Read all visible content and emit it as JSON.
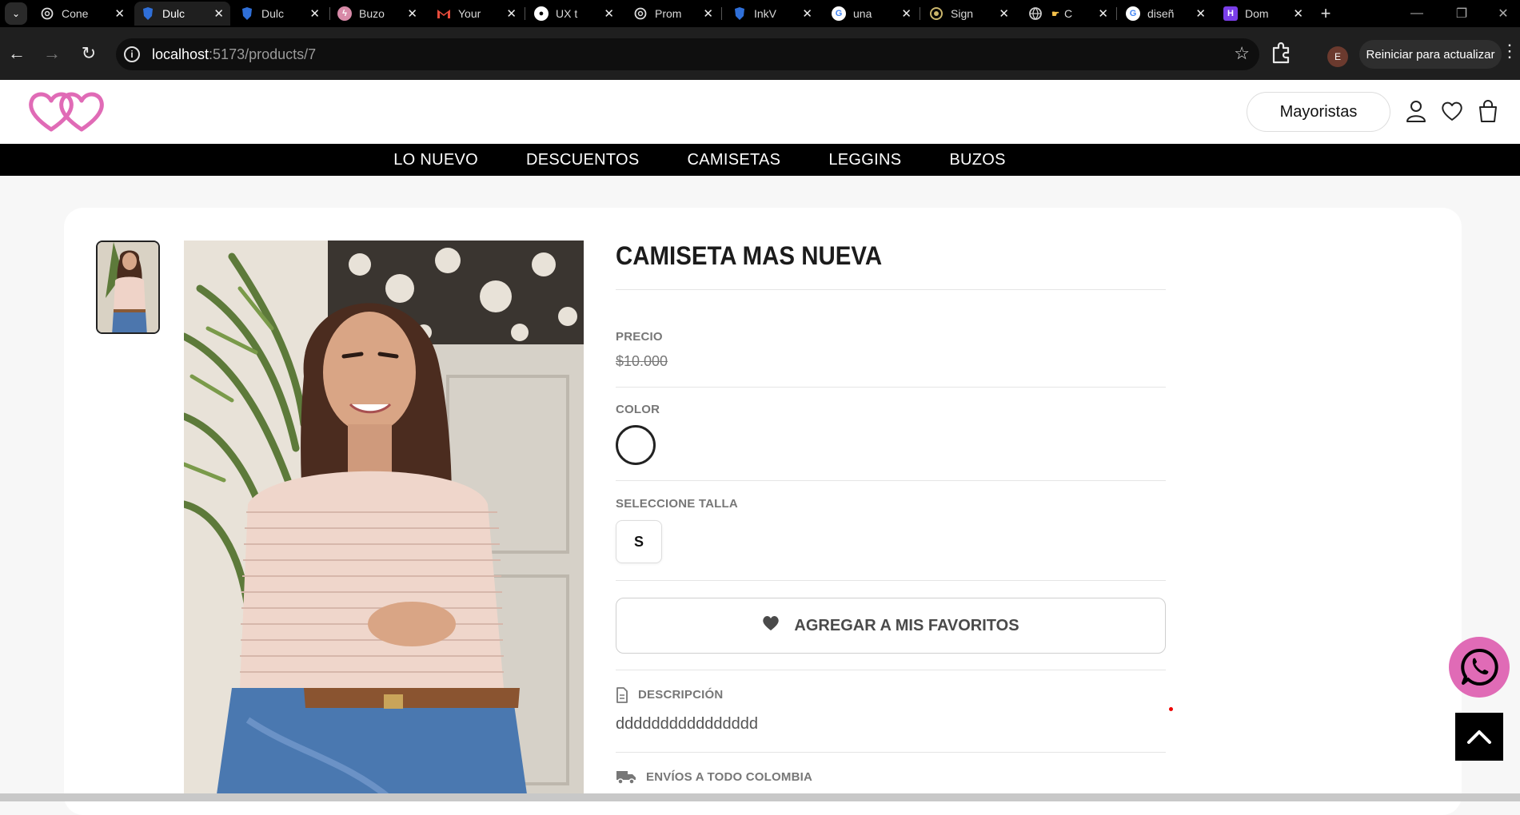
{
  "browser": {
    "tabs": [
      {
        "label": "Cone",
        "icon": "openai-icon",
        "active": false
      },
      {
        "label": "Dulc",
        "icon": "shield-logo-icon",
        "active": true
      },
      {
        "label": "Dulc",
        "icon": "shield-logo-icon",
        "active": false
      },
      {
        "label": "Buzo",
        "icon": "bolt-icon",
        "active": false
      },
      {
        "label": "Your",
        "icon": "gmail-icon",
        "active": false
      },
      {
        "label": "UX t",
        "icon": "github-icon",
        "active": false
      },
      {
        "label": "Prom",
        "icon": "openai-icon",
        "active": false
      },
      {
        "label": "InkV",
        "icon": "shield-logo-icon",
        "active": false
      },
      {
        "label": "una",
        "icon": "google-icon",
        "active": false
      },
      {
        "label": "Sign",
        "icon": "target-icon",
        "active": false
      },
      {
        "label": "C",
        "icon": "globe-icon",
        "active": false
      },
      {
        "label": "diseñ",
        "icon": "google-icon",
        "active": false
      },
      {
        "label": "Dom",
        "icon": "h-logo-icon",
        "active": false
      }
    ],
    "url_host": "localhost",
    "url_rest": ":5173/products/7",
    "profile_initial": "E",
    "update_label": "Reiniciar para actualizar"
  },
  "header": {
    "wholesale_label": "Mayoristas"
  },
  "nav": {
    "items": [
      "LO NUEVO",
      "DESCUENTOS",
      "CAMISETAS",
      "LEGGINS",
      "BUZOS"
    ]
  },
  "product": {
    "title": "CAMISETA MAS NUEVA",
    "price_label": "PRECIO",
    "price": "$10.000",
    "color_label": "COLOR",
    "size_label": "SELECCIONE TALLA",
    "sizes": [
      "S"
    ],
    "favorite_label": "AGREGAR A MIS FAVORITOS",
    "description_label": "DESCRIPCIÓN",
    "description": "dddddddddddddddd",
    "shipping_label": "ENVÍOS A TODO COLOMBIA"
  },
  "colors": {
    "brand_pink": "#e06bb6",
    "nav_bg": "#000000"
  }
}
